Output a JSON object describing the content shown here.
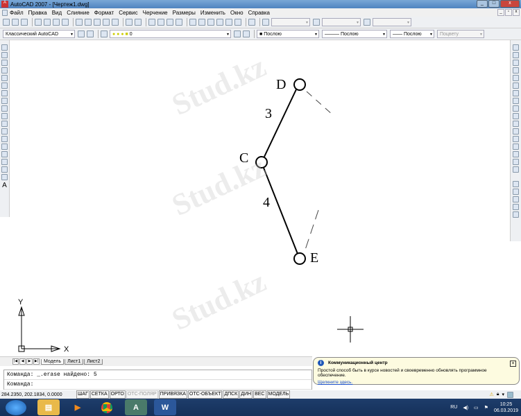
{
  "window": {
    "title": "AutoCAD 2007 - [Чертеж1.dwg]",
    "app_icon": "A"
  },
  "menu": [
    "Файл",
    "Правка",
    "Вид",
    "Слияние",
    "Формат",
    "Сервис",
    "Черчение",
    "Размеры",
    "Изменить",
    "Окно",
    "Справка"
  ],
  "toolbar2": {
    "workspace": "Классический AutoCAD",
    "layer": "0",
    "color": "Послою",
    "linetype": "Послою",
    "lineweight": "Послою",
    "plotstyle": "Поцвету"
  },
  "drawing": {
    "labels": {
      "D": "D",
      "C": "C",
      "E": "E",
      "seg1": "3",
      "seg2": "4"
    },
    "ucs": {
      "x": "X",
      "y": "Y"
    }
  },
  "tabs": {
    "model": "Модель",
    "sheet1": "Лист1",
    "sheet2": "Лист2"
  },
  "command": {
    "history": "Команда: _.erase найдено: 5",
    "prompt": "Команда:"
  },
  "status": {
    "coords": "284.2350, 202.1834, 0.0000",
    "buttons": [
      {
        "label": "ШАГ",
        "on": true
      },
      {
        "label": "СЕТКА",
        "on": true
      },
      {
        "label": "ОРТО",
        "on": true
      },
      {
        "label": "ОТС-ПОЛЯР",
        "on": false
      },
      {
        "label": "ПРИВЯЗКА",
        "on": true
      },
      {
        "label": "ОТС-ОБЪЕКТ",
        "on": true
      },
      {
        "label": "ДПСК",
        "on": true
      },
      {
        "label": "ДИН",
        "on": true
      },
      {
        "label": "ВЕС",
        "on": true
      },
      {
        "label": "МОДЕЛЬ",
        "on": true
      }
    ]
  },
  "balloon": {
    "title": "Коммуникационный центр",
    "text": "Простой способ быть в курсе новостей и своевременно обновлять программное обеспечение.",
    "link": "Щелкните здесь."
  },
  "taskbar": {
    "lang": "RU",
    "time": "10:25",
    "date": "06.03.2019"
  },
  "watermark": "Stud.kz"
}
